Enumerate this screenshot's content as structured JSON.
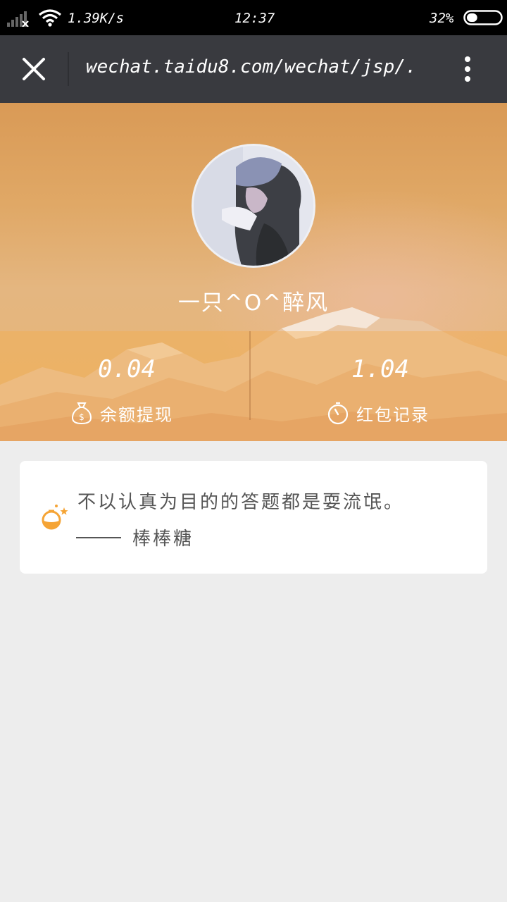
{
  "status_bar": {
    "network_speed": "1.39K/s",
    "time": "12:37",
    "battery_percent": "32%",
    "battery_level": 0.32
  },
  "browser_bar": {
    "url": "wechat.taidu8.com/wechat/jsp/."
  },
  "profile": {
    "username": "一只^O^醉风",
    "balance": {
      "value": "0.04",
      "label": "余额提现",
      "icon": "money-bag-icon"
    },
    "red_packet": {
      "value": "1.04",
      "label": "红包记录",
      "icon": "stopwatch-icon"
    }
  },
  "quote": {
    "text": "不以认真为目的的答题都是耍流氓。",
    "author": "棒棒糖",
    "icon": "flask-star-icon"
  },
  "colors": {
    "title_bar": "#393a3f",
    "header_orange": "#e0a866",
    "accent_orange": "#f5a435",
    "page_bg": "#ededed"
  }
}
